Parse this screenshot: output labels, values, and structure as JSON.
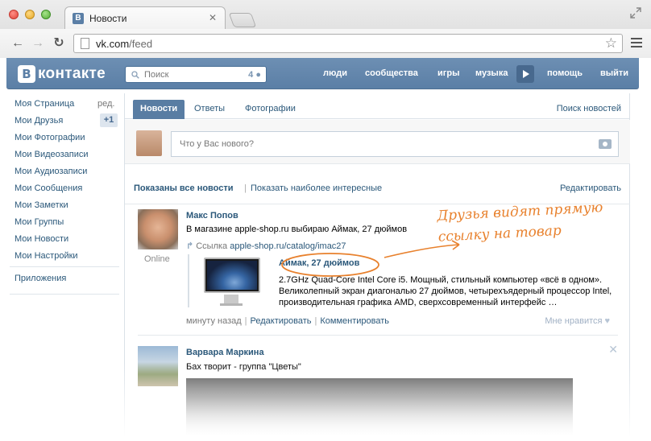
{
  "browser": {
    "tab_title": "Новости",
    "tab_favicon": "В",
    "url_host": "vk.com",
    "url_path": "/feed"
  },
  "vk": {
    "logo_letter": "В",
    "logo_text": "контакте",
    "search_placeholder": "Поиск",
    "search_count": "4",
    "nav": {
      "people": "люди",
      "communities": "сообщества",
      "games": "игры",
      "music": "музыка",
      "help": "помощь",
      "logout": "выйти"
    }
  },
  "sidebar": {
    "items": [
      "Моя Страница",
      "Мои Друзья",
      "Мои Фотографии",
      "Мои Видеозаписи",
      "Мои Аудиозаписи",
      "Мои Сообщения",
      "Мои Заметки",
      "Мои Группы",
      "Мои Новости",
      "Мои Настройки"
    ],
    "edit_label": "ред.",
    "friends_badge": "+1",
    "apps_label": "Приложения"
  },
  "feed": {
    "tabs": [
      "Новости",
      "Ответы",
      "Фотографии"
    ],
    "search_news": "Поиск новостей",
    "post_placeholder": "Что у Вас нового?",
    "filter_all": "Показаны все новости",
    "filter_interesting": "Показать наиболее интересные",
    "filter_edit": "Редактировать"
  },
  "post1": {
    "author": "Макс Попов",
    "status": "Online",
    "text": "В магазине apple-shop.ru выбираю Аймак, 27 дюймов",
    "link_label": "Ссылка",
    "link_url": "apple-shop.ru/catalog/imac27",
    "attachment_title": "Аймак, 27 дюймов",
    "attachment_desc": "2.7GHz Quad-Core Intel Core i5. Мощный, стильный компьютер «всё в одном». Великолепный экран диагональю 27 дюймов, четырехъядерный процессор Intel, производительная графика AMD, сверхсовременный интерфейс …",
    "time": "минуту назад",
    "edit": "Редактировать",
    "comment": "Комментировать",
    "like": "Мне нравится",
    "annotation": "Друзья видят прямую ссылку на товар"
  },
  "post2": {
    "author": "Варвара Маркина",
    "text": "Бах творит - группа \"Цветы\""
  },
  "colors": {
    "header_blue": "#5b7fa6",
    "link_blue": "#2b587a",
    "annotation_orange": "#e8812d"
  }
}
